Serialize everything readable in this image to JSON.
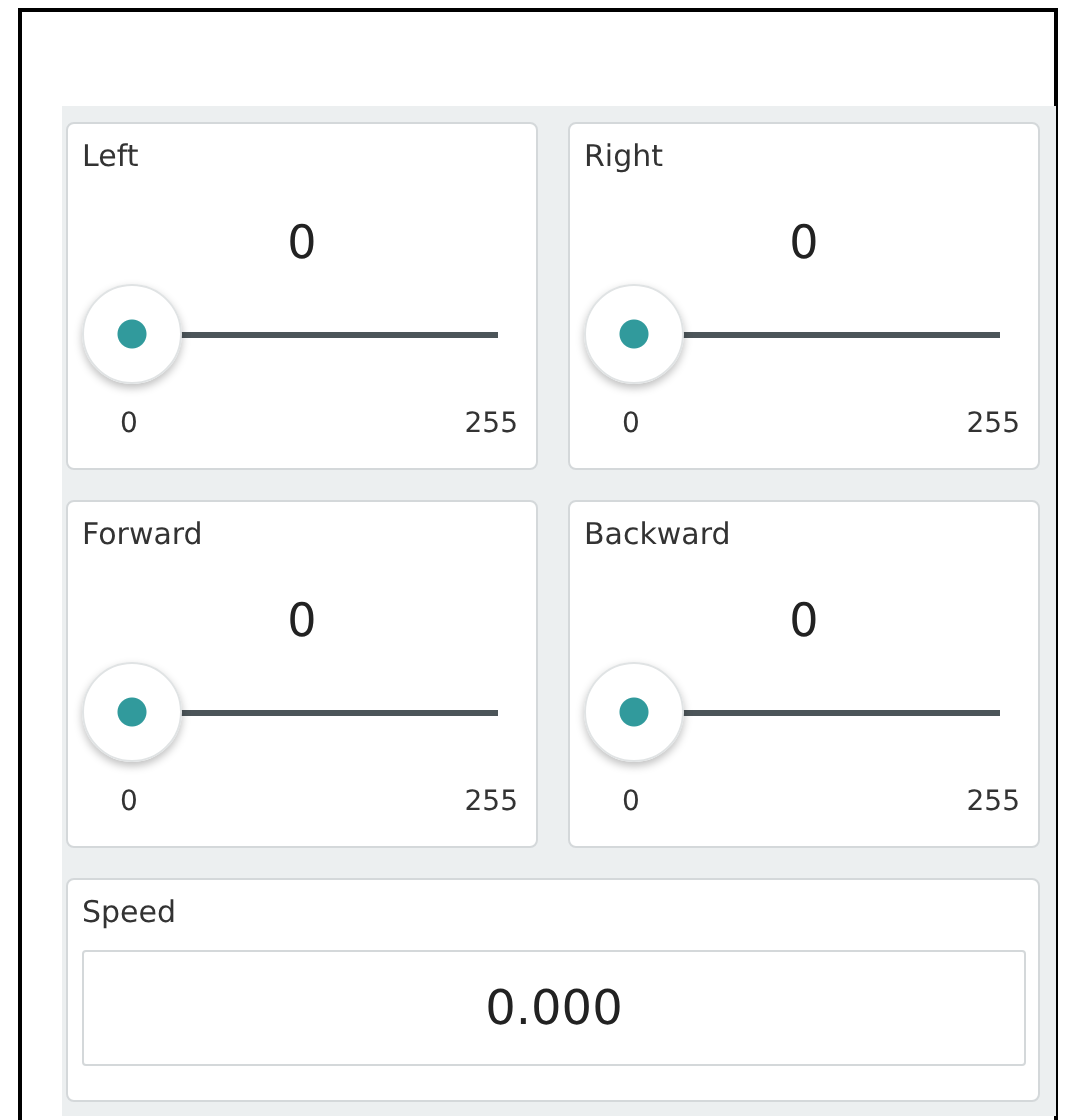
{
  "sliders": [
    {
      "label": "Left",
      "value": "0",
      "level": 0,
      "min": "0",
      "max": "255"
    },
    {
      "label": "Right",
      "value": "0",
      "level": 0,
      "min": "0",
      "max": "255"
    },
    {
      "label": "Forward",
      "value": "0",
      "level": 0,
      "min": "0",
      "max": "255"
    },
    {
      "label": "Backward",
      "value": "0",
      "level": 0,
      "min": "0",
      "max": "255"
    }
  ],
  "speed": {
    "label": "Speed",
    "value": "0.000"
  }
}
